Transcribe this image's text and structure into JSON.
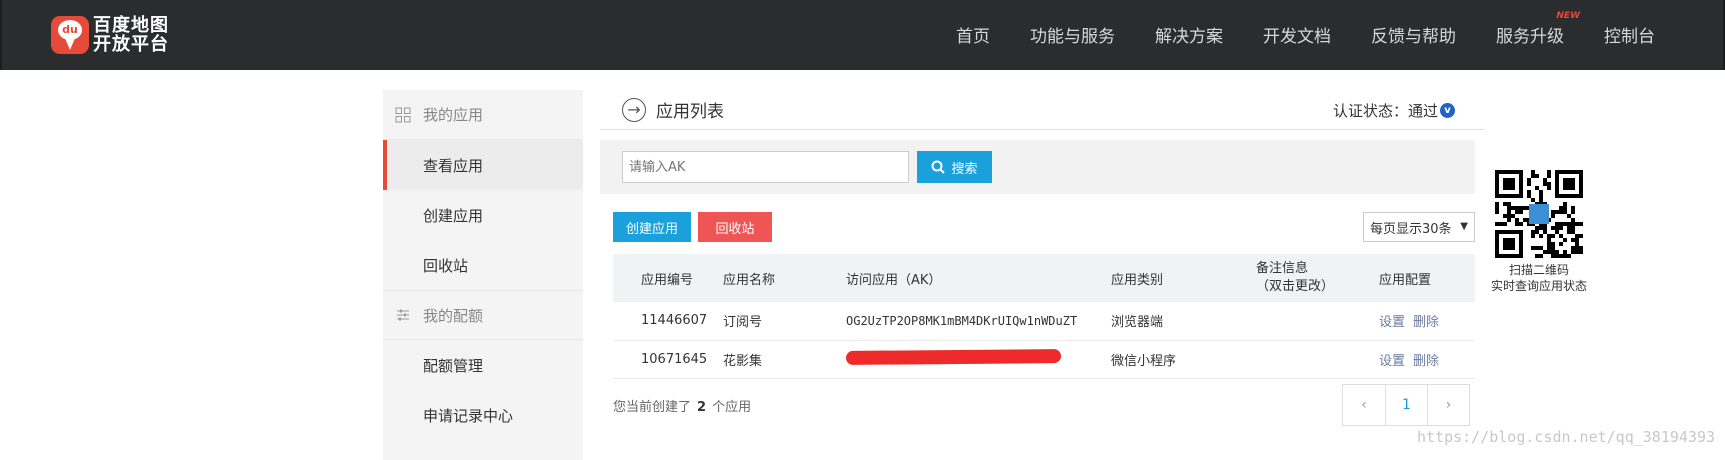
{
  "brand": {
    "line1": "百度地图",
    "line2": "开放平台",
    "badge": "du"
  },
  "nav": {
    "items": [
      "首页",
      "功能与服务",
      "解决方案",
      "开发文档",
      "反馈与帮助",
      "服务升级",
      "控制台"
    ],
    "new_tag": "NEW"
  },
  "sidebar": {
    "section1": "我的应用",
    "items1": [
      "查看应用",
      "创建应用",
      "回收站"
    ],
    "section2": "我的配额",
    "items2": [
      "配额管理",
      "申请记录中心"
    ]
  },
  "main": {
    "title": "应用列表",
    "auth_label": "认证状态：通过",
    "auth_badge": "v",
    "search_placeholder": "请输入AK",
    "search_button": "搜索",
    "create_button": "创建应用",
    "recycle_button": "回收站",
    "per_page": "每页显示30条"
  },
  "table": {
    "headers": [
      "应用编号",
      "应用名称",
      "访问应用（AK）",
      "应用类别",
      "备注信息",
      "（双击更改）",
      "应用配置"
    ],
    "rows": [
      {
        "id": "11446607",
        "name": "订阅号",
        "ak": "OG2UzTP2OP8MK1mBM4DKrUIQw1nWDuZT",
        "type": "浏览器端",
        "note": "",
        "op1": "设置",
        "op2": "删除"
      },
      {
        "id": "10671645",
        "name": "花影集",
        "ak": "",
        "type": "微信小程序",
        "note": "",
        "op1": "设置",
        "op2": "删除"
      }
    ]
  },
  "footer": {
    "prefix": "您当前创建了",
    "count": "2",
    "suffix": "个应用"
  },
  "pager": {
    "prev": "‹",
    "current": "1",
    "next": "›"
  },
  "qr": {
    "line1": "扫描二维码",
    "line2": "实时查询应用状态"
  },
  "watermark": "https://blog.csdn.net/qq_38194393",
  "colors": {
    "topbar": "#2b2c2e",
    "accent_red": "#e64a3b",
    "button_blue": "#1aa0db",
    "button_red": "#f05555"
  }
}
